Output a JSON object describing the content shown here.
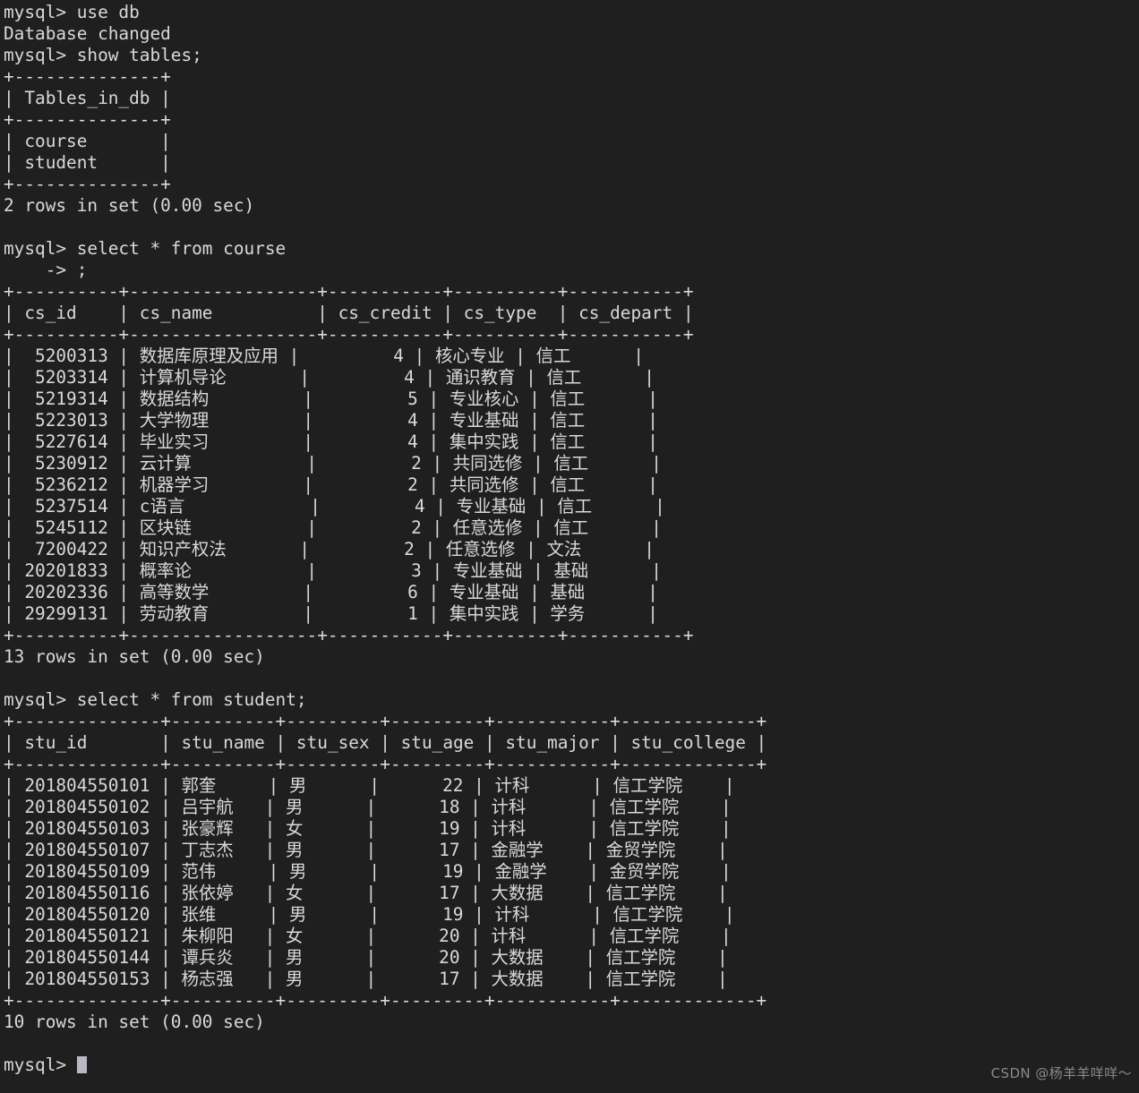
{
  "terminal": {
    "prompt": "mysql>",
    "continuation": "    ->",
    "background_color": "#1f1f1f",
    "text_color": "#d9d9d9",
    "cursor_color": "#b9b9c6"
  },
  "watermark": {
    "text": "CSDN @杨羊羊咩咩～",
    "color": "#8a8a8a"
  },
  "session": [
    {
      "kind": "command",
      "text": "use db"
    },
    {
      "kind": "output",
      "text": "Database changed"
    },
    {
      "kind": "command",
      "text": "show tables;"
    },
    {
      "kind": "table",
      "name": "tables-in-db",
      "columns": [
        {
          "header": "Tables_in_db",
          "align": "left"
        }
      ],
      "rows": [
        [
          "course"
        ],
        [
          "student"
        ]
      ]
    },
    {
      "kind": "output",
      "text": "2 rows in set (0.00 sec)"
    },
    {
      "kind": "blank"
    },
    {
      "kind": "command",
      "text": "select * from course"
    },
    {
      "kind": "continuation",
      "text": ";"
    },
    {
      "kind": "table",
      "name": "course",
      "columns": [
        {
          "header": "cs_id",
          "align": "right"
        },
        {
          "header": "cs_name",
          "align": "left"
        },
        {
          "header": "cs_credit",
          "align": "right"
        },
        {
          "header": "cs_type",
          "align": "left"
        },
        {
          "header": "cs_depart",
          "align": "left"
        }
      ],
      "rows": [
        [
          "5200313",
          "数据库原理及应用",
          "4",
          "核心专业",
          "信工"
        ],
        [
          "5203314",
          "计算机导论",
          "4",
          "通识教育",
          "信工"
        ],
        [
          "5219314",
          "数据结构",
          "5",
          "专业核心",
          "信工"
        ],
        [
          "5223013",
          "大学物理",
          "4",
          "专业基础",
          "信工"
        ],
        [
          "5227614",
          "毕业实习",
          "4",
          "集中实践",
          "信工"
        ],
        [
          "5230912",
          "云计算",
          "2",
          "共同选修",
          "信工"
        ],
        [
          "5236212",
          "机器学习",
          "2",
          "共同选修",
          "信工"
        ],
        [
          "5237514",
          "c语言",
          "4",
          "专业基础",
          "信工"
        ],
        [
          "5245112",
          "区块链",
          "2",
          "任意选修",
          "信工"
        ],
        [
          "7200422",
          "知识产权法",
          "2",
          "任意选修",
          "文法"
        ],
        [
          "20201833",
          "概率论",
          "3",
          "专业基础",
          "基础"
        ],
        [
          "20202336",
          "高等数学",
          "6",
          "专业基础",
          "基础"
        ],
        [
          "29299131",
          "劳动教育",
          "1",
          "集中实践",
          "学务"
        ]
      ]
    },
    {
      "kind": "output",
      "text": "13 rows in set (0.00 sec)"
    },
    {
      "kind": "blank"
    },
    {
      "kind": "command",
      "text": "select * from student;"
    },
    {
      "kind": "table",
      "name": "student",
      "columns": [
        {
          "header": "stu_id",
          "align": "left"
        },
        {
          "header": "stu_name",
          "align": "left"
        },
        {
          "header": "stu_sex",
          "align": "left"
        },
        {
          "header": "stu_age",
          "align": "right"
        },
        {
          "header": "stu_major",
          "align": "left"
        },
        {
          "header": "stu_college",
          "align": "left"
        }
      ],
      "rows": [
        [
          "201804550101",
          "郭奎",
          "男",
          "22",
          "计科",
          "信工学院"
        ],
        [
          "201804550102",
          "吕宇航",
          "男",
          "18",
          "计科",
          "信工学院"
        ],
        [
          "201804550103",
          "张豪辉",
          "女",
          "19",
          "计科",
          "信工学院"
        ],
        [
          "201804550107",
          "丁志杰",
          "男",
          "17",
          "金融学",
          "金贸学院"
        ],
        [
          "201804550109",
          "范伟",
          "男",
          "19",
          "金融学",
          "金贸学院"
        ],
        [
          "201804550116",
          "张依婷",
          "女",
          "17",
          "大数据",
          "信工学院"
        ],
        [
          "201804550120",
          "张维",
          "男",
          "19",
          "计科",
          "信工学院"
        ],
        [
          "201804550121",
          "朱柳阳",
          "女",
          "20",
          "计科",
          "信工学院"
        ],
        [
          "201804550144",
          "谭兵炎",
          "男",
          "20",
          "大数据",
          "信工学院"
        ],
        [
          "201804550153",
          "杨志强",
          "男",
          "17",
          "大数据",
          "信工学院"
        ]
      ]
    },
    {
      "kind": "output",
      "text": "10 rows in set (0.00 sec)"
    },
    {
      "kind": "blank"
    },
    {
      "kind": "prompt_cursor",
      "text": ""
    }
  ]
}
